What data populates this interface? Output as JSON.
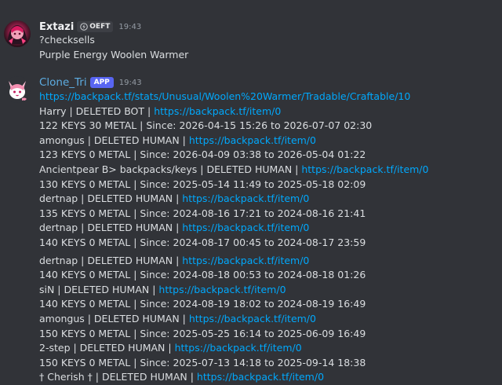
{
  "message1": {
    "username": "Extazi",
    "clan_tag": "OEFT",
    "timestamp": "19:43",
    "lines": [
      "?checksells",
      "Purple Energy Woolen Warmer"
    ]
  },
  "message2": {
    "username": "Clone_Tri",
    "app_badge": "APP",
    "timestamp": "19:43",
    "url": "https://backpack.tf/stats/Unusual/Woolen%20Warmer/Tradable/Craftable/10",
    "entries": [
      {
        "seller": "Harry | DELETED BOT | ",
        "link": "https://backpack.tf/item/0",
        "price": "122 KEYS 30 METAL | Since: 2026-04-15 15:26 to 2026-07-07 02:30"
      },
      {
        "seller": "amongus | DELETED HUMAN | ",
        "link": "https://backpack.tf/item/0",
        "price": "123 KEYS 0 METAL | Since: 2026-04-09 03:38 to 2026-05-04 01:22"
      },
      {
        "seller": "Ancientpear B> backpacks/keys | DELETED HUMAN | ",
        "link": "https://backpack.tf/item/0",
        "price": "130 KEYS 0 METAL | Since: 2025-05-14 11:49 to 2025-05-18 02:09"
      },
      {
        "seller": "dertnap | DELETED HUMAN | ",
        "link": "https://backpack.tf/item/0",
        "price": "135 KEYS 0 METAL | Since: 2024-08-16 17:21 to 2024-08-16 21:41"
      },
      {
        "seller": "dertnap | DELETED HUMAN | ",
        "link": "https://backpack.tf/item/0",
        "price": "140 KEYS 0 METAL | Since: 2024-08-17 00:45 to 2024-08-17 23:59"
      },
      {
        "seller": "dertnap | DELETED HUMAN | ",
        "link": "https://backpack.tf/item/0",
        "price": "140 KEYS 0 METAL | Since: 2024-08-18 00:53 to 2024-08-18 01:26"
      },
      {
        "seller": "siN | DELETED HUMAN | ",
        "link": "https://backpack.tf/item/0",
        "price": "140 KEYS 0 METAL | Since: 2024-08-19 18:02 to 2024-08-19 16:49"
      },
      {
        "seller": "amongus | DELETED HUMAN | ",
        "link": "https://backpack.tf/item/0",
        "price": "150 KEYS 0 METAL | Since: 2025-05-25 16:14 to 2025-06-09 16:49"
      },
      {
        "seller": "2-step | DELETED HUMAN | ",
        "link": "https://backpack.tf/item/0",
        "price": "150 KEYS 0 METAL | Since: 2025-07-13 14:18 to 2025-09-14 18:38"
      },
      {
        "seller": "† Cherish † | DELETED HUMAN | ",
        "link": "https://backpack.tf/item/0",
        "price": ""
      }
    ]
  },
  "icons": {
    "clan_tag_icon": "lightning-badge-icon",
    "bot_avatar": "pink-fox-avatar",
    "user_avatar": "red-character-avatar"
  }
}
